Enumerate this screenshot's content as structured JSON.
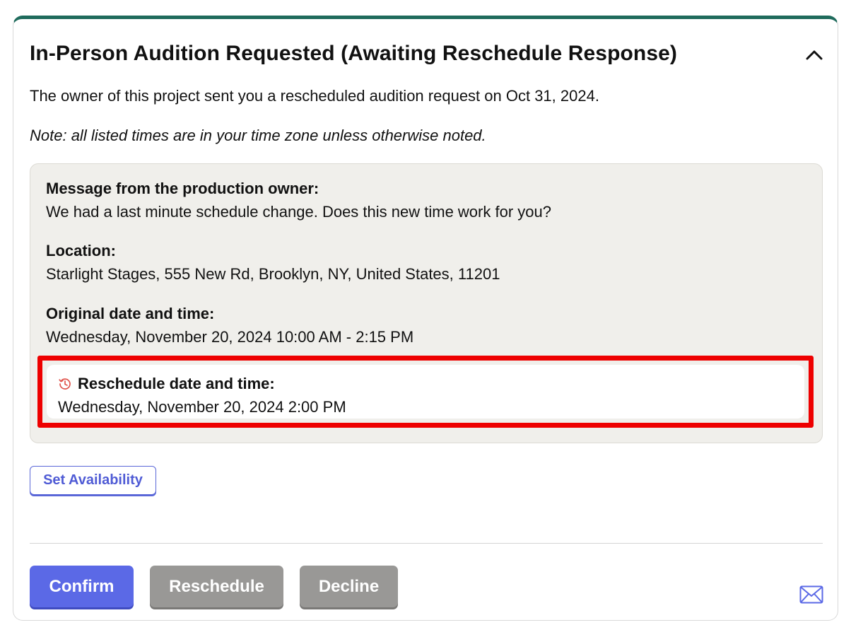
{
  "card": {
    "title": "In-Person Audition Requested (Awaiting Reschedule Response)",
    "collapse_icon": "chevron-up-icon",
    "intro": "The owner of this project sent you a rescheduled audition request on Oct 31, 2024.",
    "note": "Note: all listed times are in your time zone unless otherwise noted.",
    "accent_color": "#1f6b5c"
  },
  "details": {
    "message_label": "Message from the production owner:",
    "message_value": "We had a last minute schedule change. Does this new time work for you?",
    "location_label": "Location:",
    "location_value": "Starlight Stages, 555 New Rd, Brooklyn, NY, United States, 11201",
    "original_label": "Original date and time:",
    "original_value": "Wednesday, November 20, 2024 10:00 AM - 2:15 PM",
    "reschedule_icon": "history-clock-icon",
    "reschedule_label": "Reschedule date and time:",
    "reschedule_value": "Wednesday, November 20, 2024 2:00 PM",
    "highlight_color": "#ee0000"
  },
  "actions": {
    "set_availability": "Set Availability",
    "confirm": "Confirm",
    "reschedule": "Reschedule",
    "decline": "Decline",
    "mail_icon": "envelope-icon",
    "primary_color": "#5b69e6",
    "secondary_color": "#999896"
  }
}
